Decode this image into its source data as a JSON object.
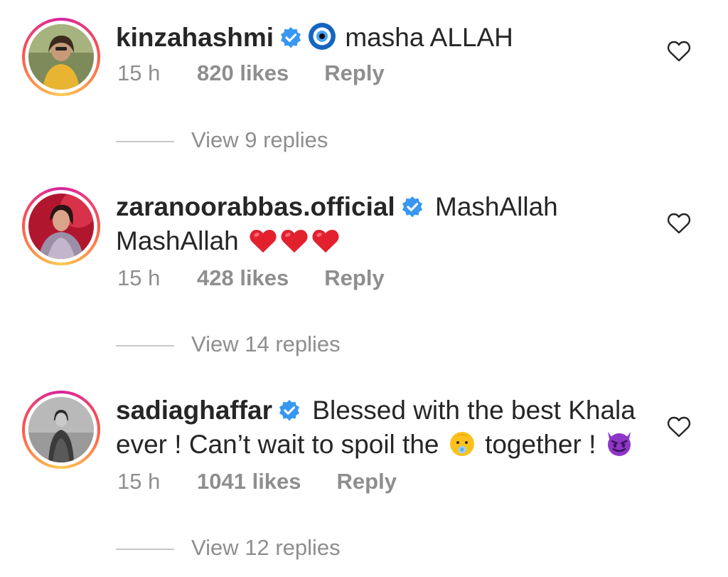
{
  "comments": [
    {
      "username": "kinzahashmi",
      "verified": true,
      "text_before": "",
      "text_main": "masha ALLAH",
      "lead_emoji": "nazar-amulet-icon",
      "time": "15 h",
      "likes": "820 likes",
      "reply": "Reply",
      "view_replies": "View 9 replies"
    },
    {
      "username": "zaranoorabbas.official",
      "verified": true,
      "text_main": "MashAllah MashAllah",
      "trailing_emoji": "red-heart-icon x3",
      "time": "15 h",
      "likes": "428 likes",
      "reply": "Reply",
      "view_replies": "View 14 replies"
    },
    {
      "username": "sadiaghaffar",
      "verified": true,
      "text_part1": "Blessed with the best Khala ever ! Can’t wait to spoil the",
      "text_part2": "together !",
      "inline_emoji": "baby-icon",
      "trailing_emoji": "smiling-devil-icon",
      "time": "15 h",
      "likes": "1041 likes",
      "reply": "Reply",
      "view_replies": "View 12 replies"
    }
  ],
  "colors": {
    "text": "#262626",
    "secondary": "#8e8e8e",
    "verified": "#3897f0",
    "divider": "#c7c7c7"
  }
}
